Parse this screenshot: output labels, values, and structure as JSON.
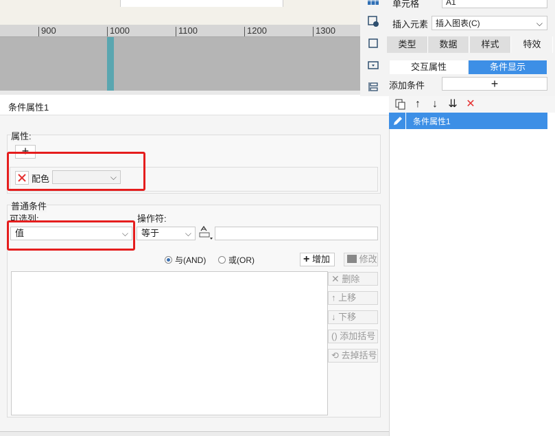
{
  "ruler": {
    "ticks": [
      "900",
      "1000",
      "1100",
      "1200",
      "1300"
    ]
  },
  "right_panel": {
    "cell_label": "单元格",
    "cell_value": "A1",
    "insert_label": "插入元素",
    "insert_value": "插入图表(C)",
    "tabs": [
      "类型",
      "数据",
      "样式",
      "特效"
    ],
    "subtabs": [
      "交互属性",
      "条件显示"
    ],
    "add_condition_label": "添加条件",
    "add_glyph": "+"
  },
  "dialog": {
    "title": "条件属性1",
    "attr_group_label": "属性:",
    "add_glyph": "+",
    "color_label": "配色",
    "cond_group_label": "普通条件",
    "column_label": "可选列:",
    "column_value": "值",
    "operator_label": "操作符:",
    "operator_value": "等于",
    "value_input": "",
    "and_label": "与(AND)",
    "or_label": "或(OR)",
    "add_button": "增加",
    "modify_button": "修改",
    "delete_button": "删除",
    "up_button": "上移",
    "down_button": "下移",
    "add_paren_button": "添加括号",
    "remove_paren_button": "去掉括号"
  },
  "list_panel": {
    "items": [
      "条件属性1"
    ]
  },
  "colors": {
    "accent": "#3d8fe6",
    "red": "#e51d1d",
    "cursor": "#5aa6b0"
  }
}
